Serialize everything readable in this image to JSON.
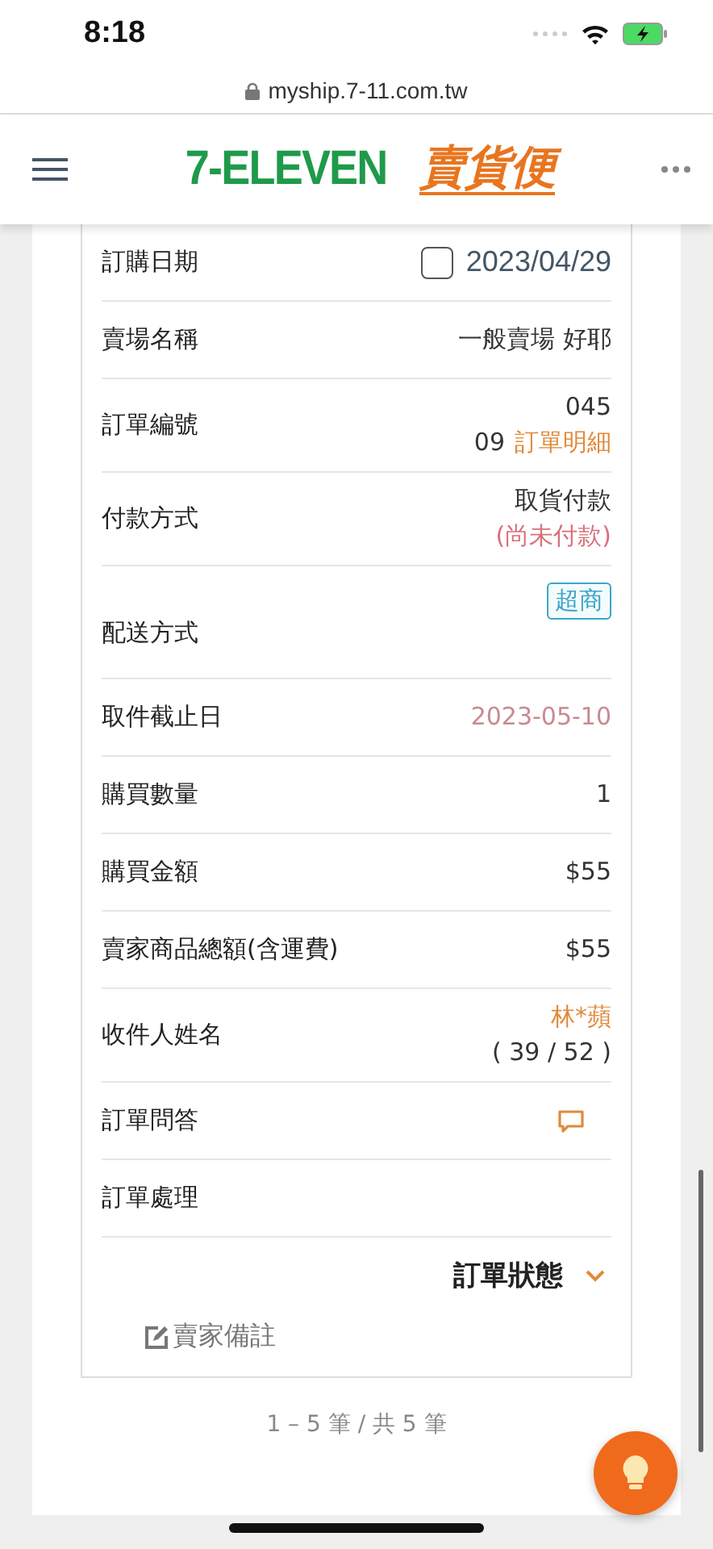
{
  "status_bar": {
    "time": "8:18"
  },
  "browser": {
    "url": "myship.7-11.com.tw"
  },
  "header": {
    "brand": "7-ELEVEN",
    "service": "賣貨便"
  },
  "rows": [
    {
      "label": "訂購日期",
      "kind": "date",
      "checked": false,
      "value": "2023/04/29"
    },
    {
      "label": "賣場名稱",
      "kind": "text",
      "lines": [
        {
          "text": "一般賣場 好耶",
          "color": "#333333"
        }
      ]
    },
    {
      "label": "訂單編號",
      "kind": "text",
      "lines": [
        {
          "text": "045",
          "color": "#333333"
        },
        {
          "text": "09",
          "color": "#333333",
          "link": "訂單明細"
        }
      ]
    },
    {
      "label": "付款方式",
      "kind": "text",
      "lines": [
        {
          "text": "取貨付款",
          "color": "#333333"
        },
        {
          "text": "(尚未付款)",
          "color": "#d9707a"
        }
      ]
    },
    {
      "label": "配送方式",
      "kind": "tag",
      "value": "超商"
    },
    {
      "label": "取件截止日",
      "kind": "text",
      "lines": [
        {
          "text": "2023-05-10",
          "color": "#c98a90"
        }
      ]
    },
    {
      "label": "購買數量",
      "kind": "text",
      "lines": [
        {
          "text": "1",
          "color": "#333333"
        }
      ]
    },
    {
      "label": "購買金額",
      "kind": "text",
      "lines": [
        {
          "text": "$55",
          "color": "#333333"
        }
      ]
    },
    {
      "label": "賣家商品總額(含運費)",
      "kind": "text",
      "lines": [
        {
          "text": "$55",
          "color": "#333333"
        }
      ]
    },
    {
      "label": "收件人姓名",
      "kind": "text",
      "lines": [
        {
          "text": "林*蘋",
          "color": "#e08a3a"
        },
        {
          "text": "( 39 / 52 )",
          "color": "#333333"
        }
      ]
    },
    {
      "label": "訂單問答",
      "kind": "chat"
    },
    {
      "label": "訂單處理",
      "kind": "text",
      "lines": []
    }
  ],
  "status_toggle": {
    "label": "訂單狀態",
    "expanded": false
  },
  "seller_note": {
    "label": "賣家備註"
  },
  "pagination": {
    "text": "1 – 5 筆 / 共 5 筆"
  }
}
